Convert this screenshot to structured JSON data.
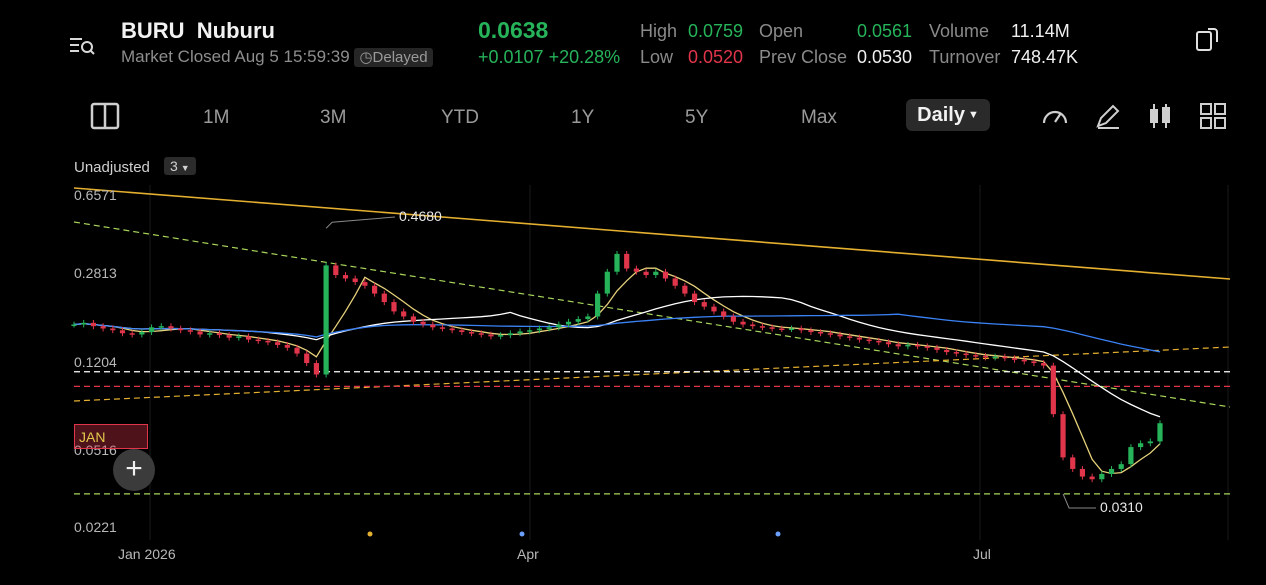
{
  "header": {
    "symbol": "BURU",
    "name": "Nuburu",
    "market_status": "Market Closed Aug 5 15:59:39",
    "delay_badge": "Delayed",
    "price": "0.0638",
    "change": "+0.0107",
    "change_pct": "+20.28%",
    "stats": {
      "high_label": "High",
      "high": "0.0759",
      "low_label": "Low",
      "low": "0.0520",
      "open_label": "Open",
      "open": "0.0561",
      "prev_close_label": "Prev Close",
      "prev_close": "0.0530",
      "volume_label": "Volume",
      "volume": "11.14M",
      "turnover_label": "Turnover",
      "turnover": "748.47K"
    }
  },
  "toolbar": {
    "ranges": [
      "1M",
      "3M",
      "YTD",
      "1Y",
      "5Y",
      "Max"
    ],
    "interval": "Daily",
    "icons": [
      "panel-toggle-icon",
      "gauge-icon",
      "draw-pen-icon",
      "candlestick-icon",
      "grid-layout-icon"
    ]
  },
  "chart_options": {
    "adjust_label": "Unadjusted",
    "overlay_count": "3"
  },
  "chart_data": {
    "type": "candlestick",
    "y_scale": "log",
    "y_tick_labels": [
      "0.6571",
      "0.2813",
      "0.1204",
      "0.0516",
      "0.0221"
    ],
    "ylim": [
      0.0221,
      0.6571
    ],
    "x_tick_labels": [
      "Jan 2026",
      "Apr",
      "Jul"
    ],
    "annotations": {
      "high_callout": "0.4680",
      "low_callout": "0.0310",
      "tag": "JAN"
    },
    "close": [
      0.175,
      0.178,
      0.172,
      0.168,
      0.165,
      0.16,
      0.158,
      0.162,
      0.17,
      0.172,
      0.168,
      0.165,
      0.163,
      0.158,
      0.16,
      0.157,
      0.153,
      0.155,
      0.15,
      0.148,
      0.146,
      0.142,
      0.138,
      0.13,
      0.118,
      0.105,
      0.32,
      0.29,
      0.28,
      0.27,
      0.26,
      0.24,
      0.22,
      0.2,
      0.19,
      0.18,
      0.175,
      0.17,
      0.168,
      0.165,
      0.162,
      0.16,
      0.158,
      0.155,
      0.157,
      0.16,
      0.163,
      0.165,
      0.168,
      0.17,
      0.175,
      0.18,
      0.185,
      0.19,
      0.24,
      0.3,
      0.36,
      0.31,
      0.3,
      0.29,
      0.3,
      0.28,
      0.26,
      0.24,
      0.22,
      0.21,
      0.2,
      0.19,
      0.18,
      0.175,
      0.172,
      0.17,
      0.168,
      0.167,
      0.168,
      0.165,
      0.162,
      0.16,
      0.158,
      0.155,
      0.153,
      0.15,
      0.148,
      0.146,
      0.143,
      0.14,
      0.142,
      0.14,
      0.138,
      0.135,
      0.132,
      0.13,
      0.128,
      0.127,
      0.125,
      0.126,
      0.124,
      0.122,
      0.12,
      0.118,
      0.115,
      0.07,
      0.045,
      0.04,
      0.037,
      0.036,
      0.038,
      0.04,
      0.042,
      0.05,
      0.052,
      0.053,
      0.0638
    ],
    "series": [
      {
        "name": "MA-short",
        "color": "#e6d17a"
      },
      {
        "name": "MA-mid",
        "color": "#ffffff"
      },
      {
        "name": "MA-long",
        "color": "#3b82f6"
      }
    ],
    "levels": [
      {
        "value": 0.108,
        "color": "#ffffff",
        "style": "dashed"
      },
      {
        "value": 0.093,
        "color": "#e0354a",
        "style": "dashed"
      },
      {
        "value": 0.031,
        "color": "#a8d65a",
        "style": "dashed"
      }
    ]
  }
}
